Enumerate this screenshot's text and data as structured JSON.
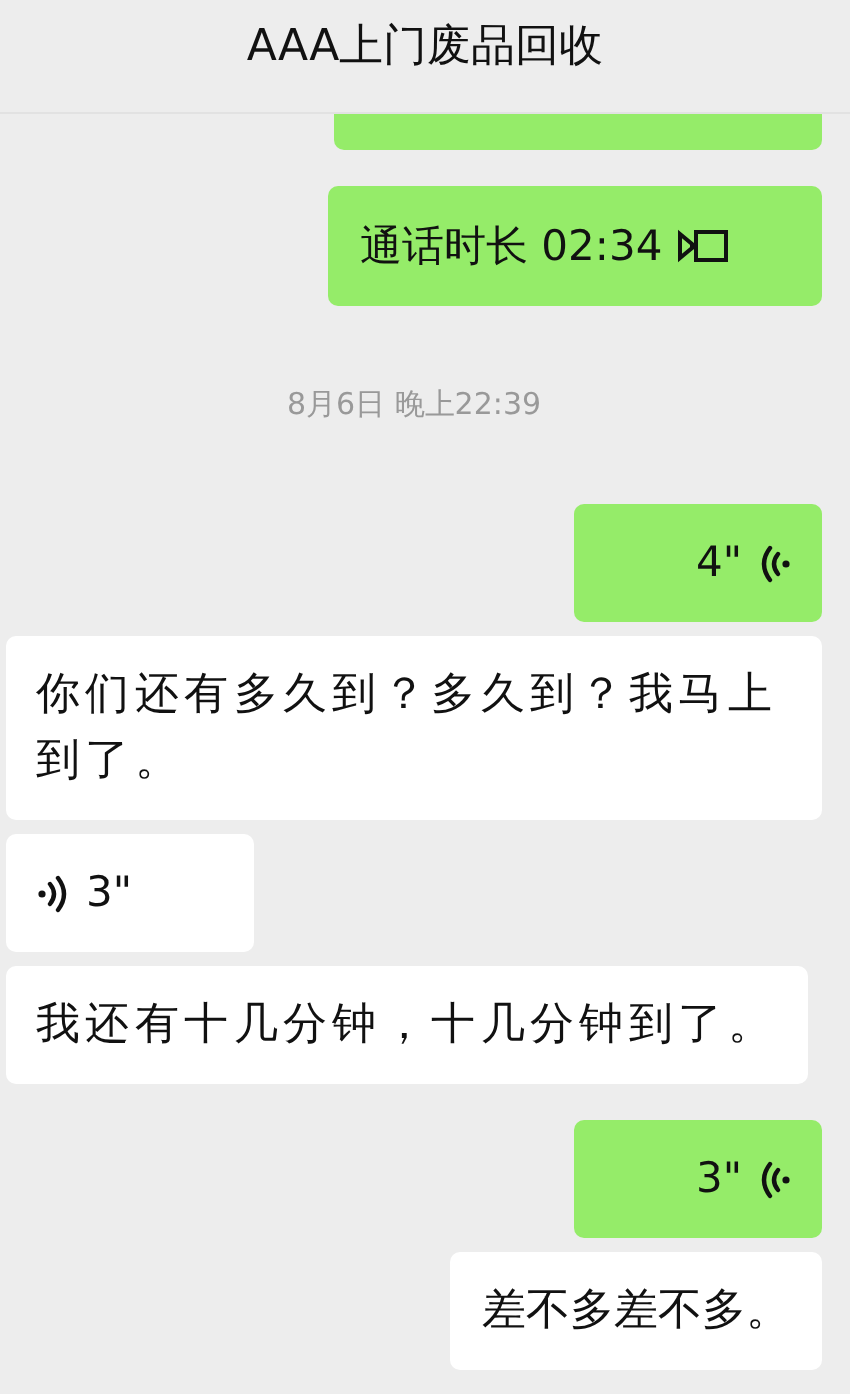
{
  "header": {
    "title": "AAA上门废品回收"
  },
  "messages": [
    {
      "kind": "clipped",
      "color": "#95ec69"
    },
    {
      "kind": "call",
      "outgoing": true,
      "color": "#95ec69",
      "text": "通话时长 02:34"
    },
    {
      "kind": "timestamp",
      "text": "8月6日 晚上22:39"
    },
    {
      "kind": "voice",
      "outgoing": true,
      "color": "#95ec69",
      "duration": "4\""
    },
    {
      "kind": "text",
      "outgoing": false,
      "color": "#ffffff",
      "text": "你们还有多久到？多久到？我马上到了。"
    },
    {
      "kind": "voice",
      "outgoing": false,
      "color": "#ffffff",
      "duration": "3\""
    },
    {
      "kind": "text",
      "outgoing": false,
      "color": "#ffffff",
      "text": "我还有十几分钟，十几分钟到了。"
    },
    {
      "kind": "voice",
      "outgoing": true,
      "color": "#95ec69",
      "duration": "3\""
    },
    {
      "kind": "text",
      "outgoing": true,
      "color": "#ffffff",
      "text": "差不多差不多。"
    }
  ]
}
